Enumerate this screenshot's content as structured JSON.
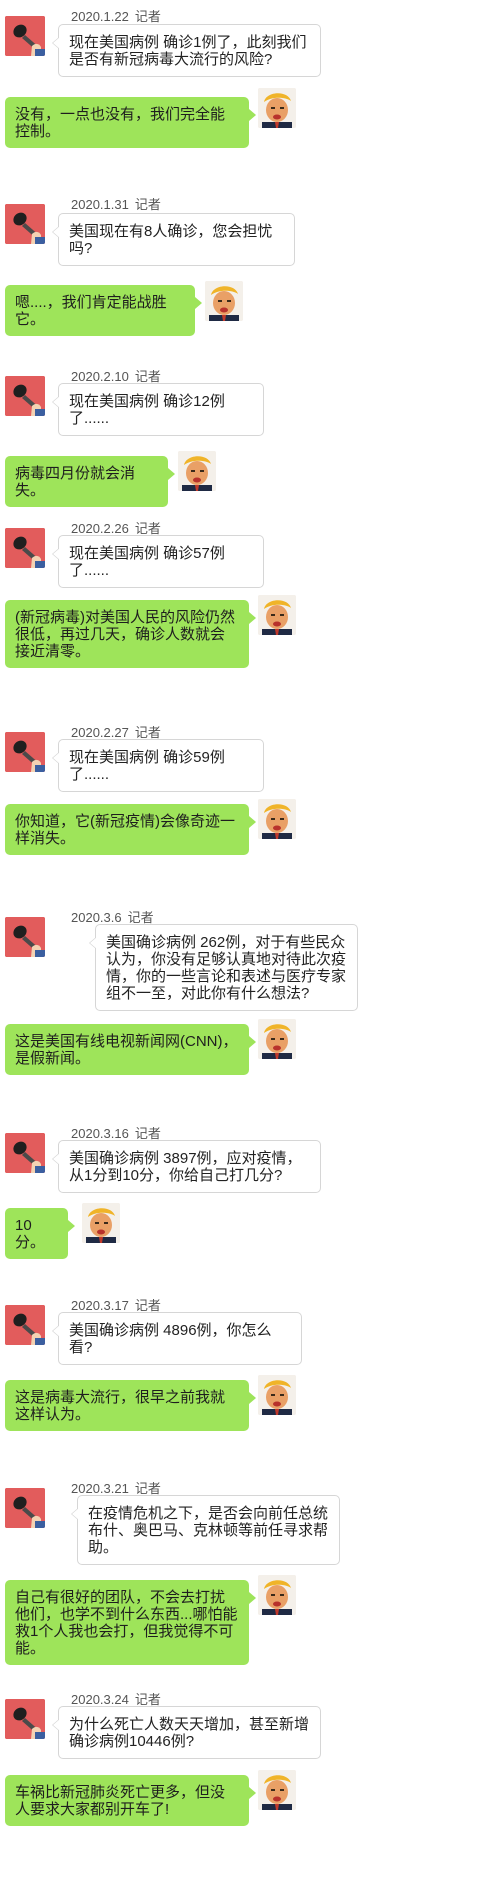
{
  "reporter_label": "记者",
  "exchanges": [
    {
      "date": "2020.1.22",
      "question": "现在美国病例 确诊1例了，此刻我们是否有新冠病毒大流行的风险?",
      "answer": "没有，一点也没有，我们完全能控制。"
    },
    {
      "date": "2020.1.31",
      "question": "美国现在有8人确诊，您会担忧吗?",
      "answer": "嗯....，我们肯定能战胜它。"
    },
    {
      "date": "2020.2.10",
      "question": "现在美国病例 确诊12例了......",
      "answer": "病毒四月份就会消失。"
    },
    {
      "date": "2020.2.26",
      "question": "现在美国病例 确诊57例了......",
      "answer": "(新冠病毒)对美国人民的风险仍然很低，再过几天，确诊人数就会接近清零。"
    },
    {
      "date": "2020.2.27",
      "question": "现在美国病例 确诊59例了......",
      "answer": "你知道，它(新冠疫情)会像奇迹一样消失。"
    },
    {
      "date": "2020.3.6",
      "question": "美国确诊病例 262例，对于有些民众认为，你没有足够认真地对待此次疫情，你的一些言论和表述与医疗专家组不一至，对此你有什么想法?",
      "answer": "这是美国有线电视新闻网(CNN)，是假新闻。"
    },
    {
      "date": "2020.3.16",
      "question": "美国确诊病例 3897例，应对疫情，从1分到10分，你给自己打几分?",
      "answer": "10分。"
    },
    {
      "date": "2020.3.17",
      "question": "美国确诊病例 4896例，你怎么看?",
      "answer": "这是病毒大流行，很早之前我就这样认为。"
    },
    {
      "date": "2020.3.21",
      "question": "在疫情危机之下，是否会向前任总统布什、奥巴马、克林顿等前任寻求帮助。",
      "answer": "自己有很好的团队，不会去打扰他们，也学不到什么东西...哪怕能救1个人我也会打，但我觉得不可能。"
    },
    {
      "date": "2020.3.24",
      "question": "为什么死亡人数天天增加，甚至新增确诊病例10446例?",
      "answer": "车祸比新冠肺炎死亡更多，但没人要求大家都别开车了!"
    }
  ]
}
